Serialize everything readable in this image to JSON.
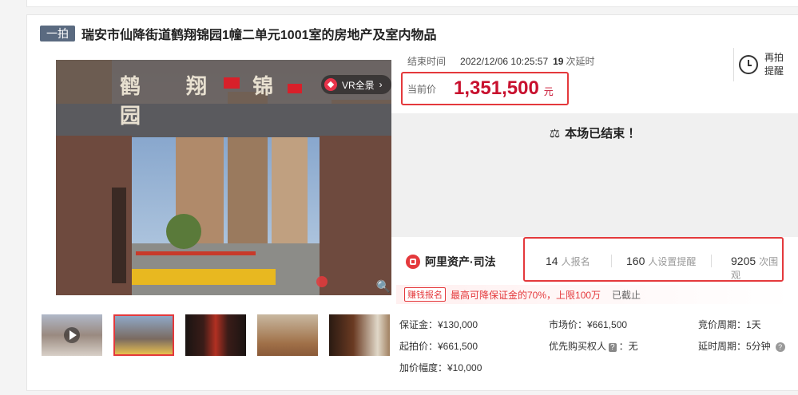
{
  "header": {
    "badge": "一拍",
    "title": "瑞安市仙降街道鹤翔锦园1幢二单元1001室的房地产及室内物品"
  },
  "gallery": {
    "vr_label": "VR全景",
    "vr_arrow": "›",
    "zoom_icon": "🔍",
    "gate_sign": "鹤 翔 锦 园",
    "thumbnails": [
      "thumb-1",
      "thumb-2",
      "thumb-3",
      "thumb-4",
      "thumb-5"
    ],
    "selected_index": 1
  },
  "auction": {
    "end_label": "结束时间",
    "end_time": "2022/12/06 10:25:57",
    "delay_count": "19",
    "delay_label": "次延时",
    "remind_label": "再拍提醒",
    "price_label": "当前价",
    "price_value": "1,351,500",
    "price_unit": "元",
    "ended_text": "本场已结束 ！",
    "ended_icon": "⚖"
  },
  "platform": {
    "name": "阿里资产·司法"
  },
  "stats": {
    "signup_count": "14",
    "signup_label": "人报名",
    "remind_count": "160",
    "remind_label": "人设置提醒",
    "watch_count": "9205",
    "watch_label": "次围观"
  },
  "notice": {
    "tag": "赚钱报名",
    "message": "最高可降保证金的70%，上限100万",
    "status": "已截止"
  },
  "details": {
    "deposit": "保证金：¥130,000",
    "start_price": "起拍价：¥661,500",
    "increment": "加价幅度：¥10,000",
    "market_price": "市场价：¥661,500",
    "priority_prefix": "优先购买权人",
    "priority_badge": "?",
    "priority_value": "：无",
    "cycle": "竞价周期：1天",
    "delay_cycle": "延时周期：5分钟",
    "help_icon": "?"
  },
  "colors": {
    "accent": "#e4393c",
    "price": "#c8102e",
    "badge": "#5a6a80"
  }
}
